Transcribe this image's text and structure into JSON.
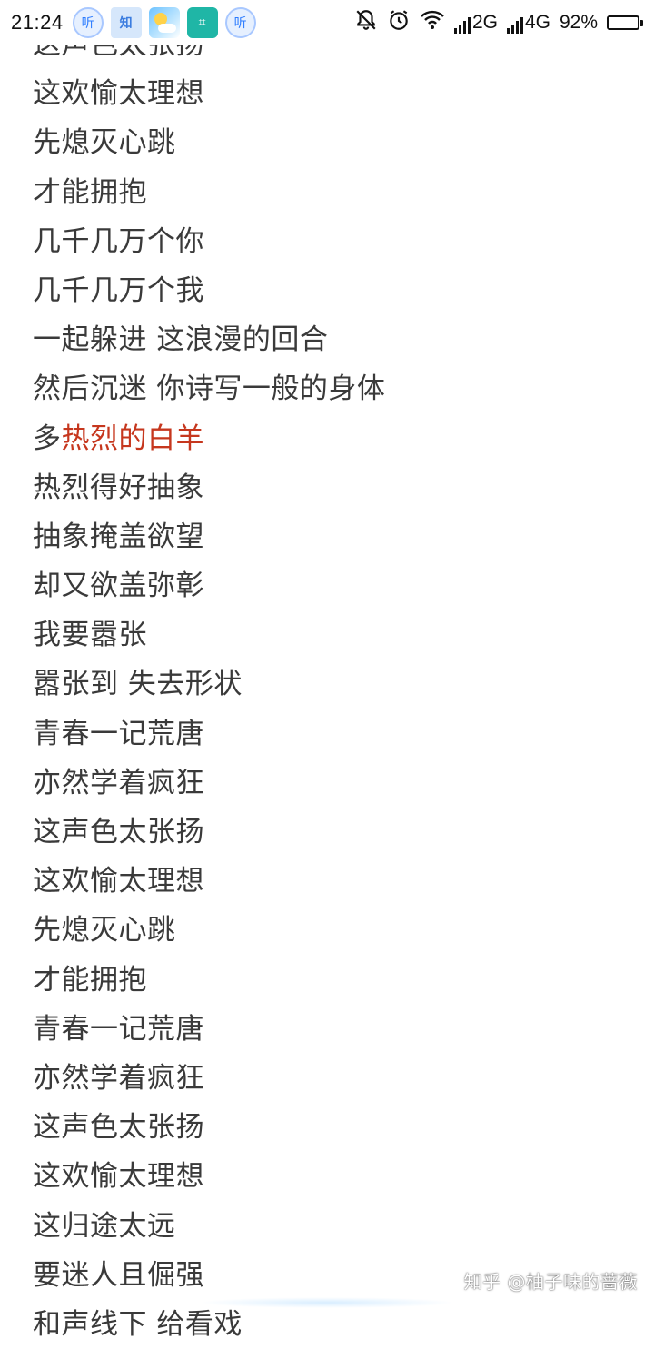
{
  "status_bar": {
    "time": "21:24",
    "notifications": [
      {
        "name": "ting",
        "label": "听"
      },
      {
        "name": "zhihu",
        "label": "知"
      },
      {
        "name": "weather",
        "label": ""
      },
      {
        "name": "scan",
        "label": "⌗"
      },
      {
        "name": "ting",
        "label": "听"
      }
    ],
    "network_1": "2G",
    "network_2": "4G",
    "battery_percent": "92%",
    "battery_level": 0.92
  },
  "lyrics": {
    "lines": [
      {
        "text": "这声色太张扬"
      },
      {
        "text": "这欢愉太理想"
      },
      {
        "text": "先熄灭心跳"
      },
      {
        "text": "才能拥抱"
      },
      {
        "text": "几千几万个你"
      },
      {
        "text": "几千几万个我"
      },
      {
        "text": "一起躲进 这浪漫的回合"
      },
      {
        "text": "然后沉迷 你诗写一般的身体"
      },
      {
        "text": "多",
        "accent": "热烈的白羊"
      },
      {
        "text": "热烈得好抽象"
      },
      {
        "text": "抽象掩盖欲望"
      },
      {
        "text": "却又欲盖弥彰"
      },
      {
        "text": "我要嚣张"
      },
      {
        "text": "嚣张到 失去形状"
      },
      {
        "text": "青春一记荒唐"
      },
      {
        "text": "亦然学着疯狂"
      },
      {
        "text": "这声色太张扬"
      },
      {
        "text": "这欢愉太理想"
      },
      {
        "text": "先熄灭心跳"
      },
      {
        "text": "才能拥抱"
      },
      {
        "text": "青春一记荒唐"
      },
      {
        "text": "亦然学着疯狂"
      },
      {
        "text": "这声色太张扬"
      },
      {
        "text": "这欢愉太理想"
      },
      {
        "text": "这归途太远"
      },
      {
        "text": "要迷人且倔强"
      },
      {
        "text": "和声线下 给看戏"
      }
    ]
  },
  "watermark": "知乎 @柚子味的蔷薇",
  "colors": {
    "text": "#3a3a3a",
    "accent": "#c6371e",
    "background": "#ffffff"
  }
}
